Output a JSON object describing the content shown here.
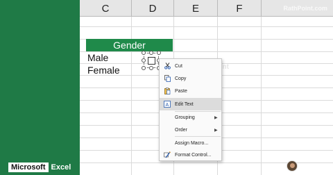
{
  "watermark": {
    "site": "RathPoint.com",
    "inline": "Rath Point"
  },
  "columns": [
    "C",
    "D",
    "E",
    "F"
  ],
  "sheet": {
    "header_cell": "Gender",
    "cells": [
      "Male",
      "Female"
    ]
  },
  "context_menu": {
    "items": [
      {
        "label": "Cut",
        "icon": "scissors-icon",
        "has_submenu": false,
        "highlighted": false
      },
      {
        "label": "Copy",
        "icon": "copy-icon",
        "has_submenu": false,
        "highlighted": false
      },
      {
        "label": "Paste",
        "icon": "paste-icon",
        "has_submenu": false,
        "highlighted": false
      },
      {
        "label": "Edit Text",
        "icon": "edit-text-icon",
        "has_submenu": false,
        "highlighted": true
      },
      {
        "label": "Grouping",
        "icon": "",
        "has_submenu": true,
        "highlighted": false
      },
      {
        "label": "Order",
        "icon": "",
        "has_submenu": true,
        "highlighted": false
      },
      {
        "label": "Assign Macro...",
        "icon": "",
        "has_submenu": false,
        "highlighted": false
      },
      {
        "label": "Format Control...",
        "icon": "format-control-icon",
        "has_submenu": false,
        "highlighted": false
      }
    ]
  },
  "branding": {
    "brand": "Microsoft",
    "app": "Excel"
  },
  "author": {
    "name": "Rath Point"
  },
  "colors": {
    "accent_green": "#1f7a46",
    "header_green": "#1f8a4a",
    "highlight": "#dcdcdc"
  }
}
